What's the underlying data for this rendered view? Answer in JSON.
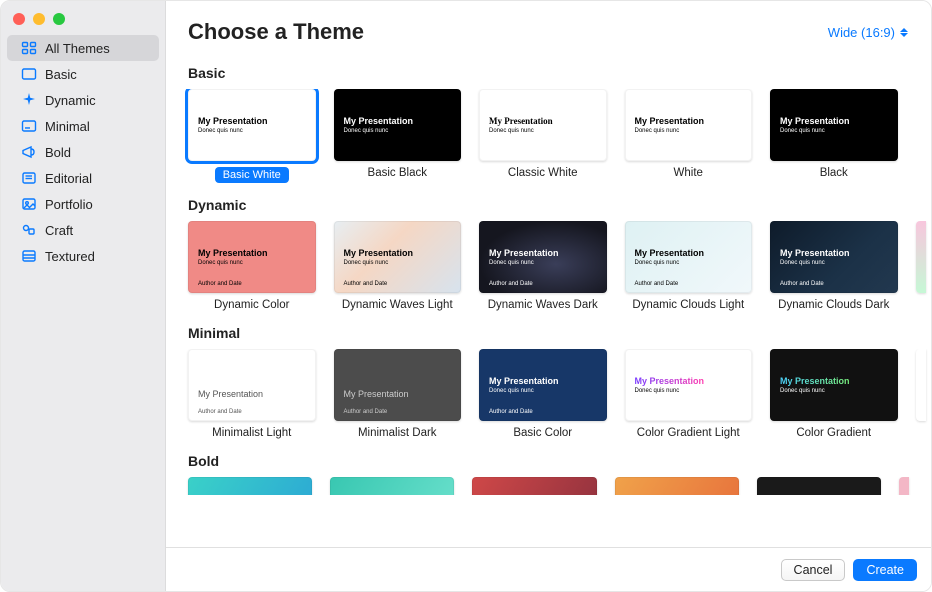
{
  "header": {
    "title": "Choose a Theme",
    "aspect_label": "Wide (16:9)"
  },
  "preview": {
    "title": "My Presentation",
    "subtitle": "Donec quis nunc",
    "footer": "Author and Date"
  },
  "sidebar": {
    "items": [
      {
        "label": "All Themes",
        "selected": true
      },
      {
        "label": "Basic"
      },
      {
        "label": "Dynamic"
      },
      {
        "label": "Minimal"
      },
      {
        "label": "Bold"
      },
      {
        "label": "Editorial"
      },
      {
        "label": "Portfolio"
      },
      {
        "label": "Craft"
      },
      {
        "label": "Textured"
      }
    ]
  },
  "sections": [
    {
      "title": "Basic",
      "themes": [
        {
          "label": "Basic White",
          "selected": true
        },
        {
          "label": "Basic Black"
        },
        {
          "label": "Classic White"
        },
        {
          "label": "White"
        },
        {
          "label": "Black"
        }
      ]
    },
    {
      "title": "Dynamic",
      "themes": [
        {
          "label": "Dynamic Color"
        },
        {
          "label": "Dynamic Waves Light"
        },
        {
          "label": "Dynamic Waves Dark"
        },
        {
          "label": "Dynamic Clouds Light"
        },
        {
          "label": "Dynamic Clouds Dark"
        }
      ]
    },
    {
      "title": "Minimal",
      "themes": [
        {
          "label": "Minimalist Light"
        },
        {
          "label": "Minimalist Dark"
        },
        {
          "label": "Basic Color"
        },
        {
          "label": "Color Gradient Light"
        },
        {
          "label": "Color Gradient"
        }
      ]
    },
    {
      "title": "Bold",
      "themes": []
    }
  ],
  "footer": {
    "cancel": "Cancel",
    "create": "Create"
  }
}
